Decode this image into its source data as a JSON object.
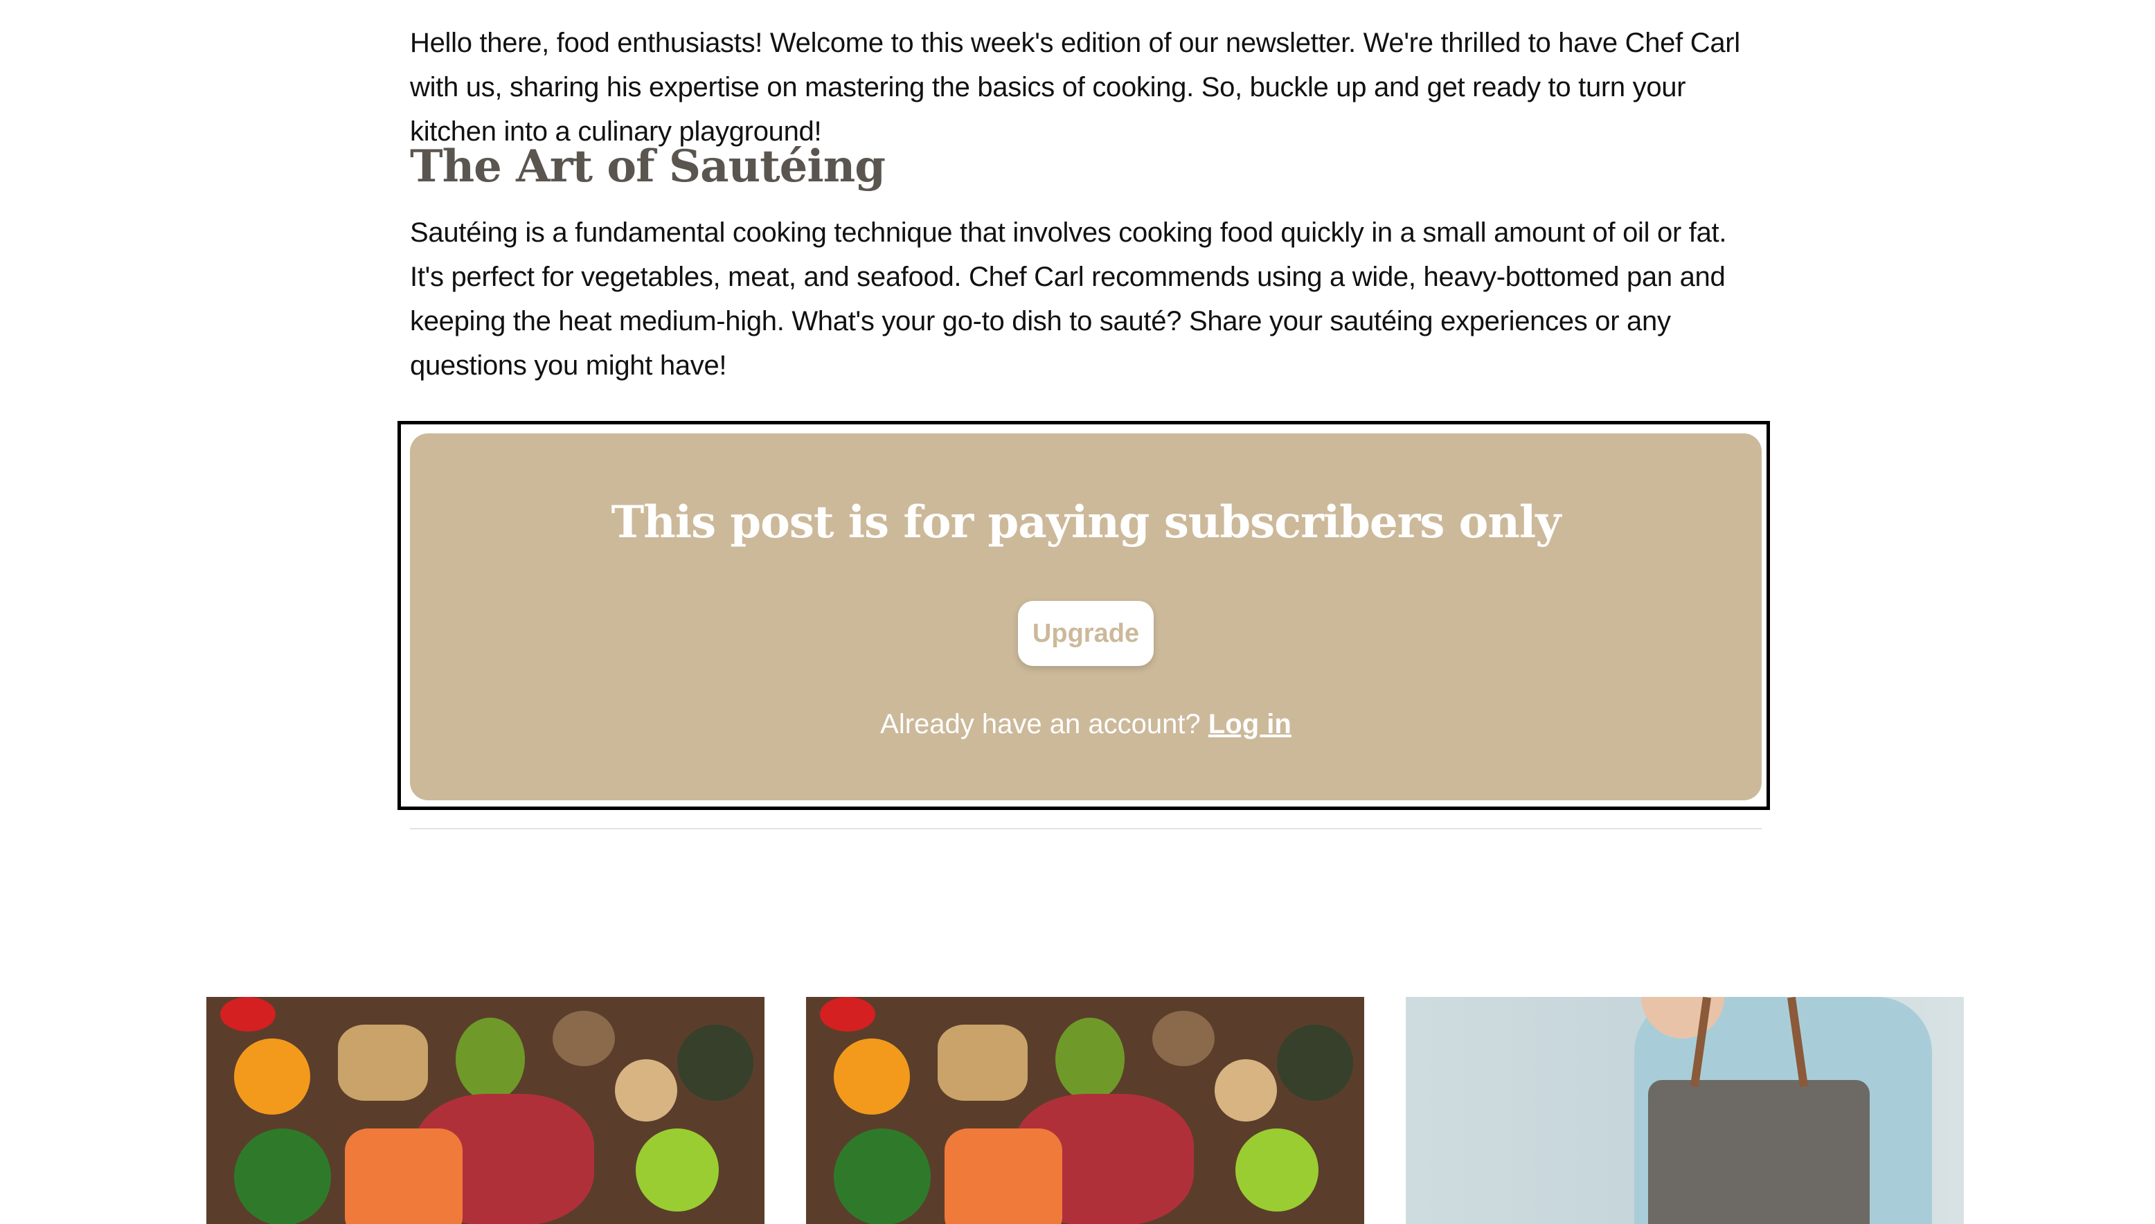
{
  "intro": {
    "text": "Hello there, food enthusiasts! Welcome to this week's edition of our newsletter. We're thrilled to have Chef Carl with us, sharing his expertise on mastering the basics of cooking. So, buckle up and get ready to turn your kitchen into a culinary playground!"
  },
  "section": {
    "heading": "The Art of Sautéing",
    "body": "Sautéing is a fundamental cooking technique that involves cooking food quickly in a small amount of oil or fat. It's perfect for vegetables, meat, and seafood. Chef Carl recommends using a wide, heavy-bottomed pan and keeping the heat medium-high. What's your go-to dish to sauté? Share your sautéing experiences or any questions you might have!"
  },
  "paywall": {
    "title": "This post is for paying subscribers only",
    "upgrade_label": "Upgrade",
    "account_prompt": "Already have an account?",
    "login_label": "Log in",
    "background_color": "#ccb99a"
  },
  "related_posts": [
    {
      "image": "food-ingredients-image"
    },
    {
      "image": "food-ingredients-image"
    },
    {
      "image": "chef-image"
    }
  ]
}
